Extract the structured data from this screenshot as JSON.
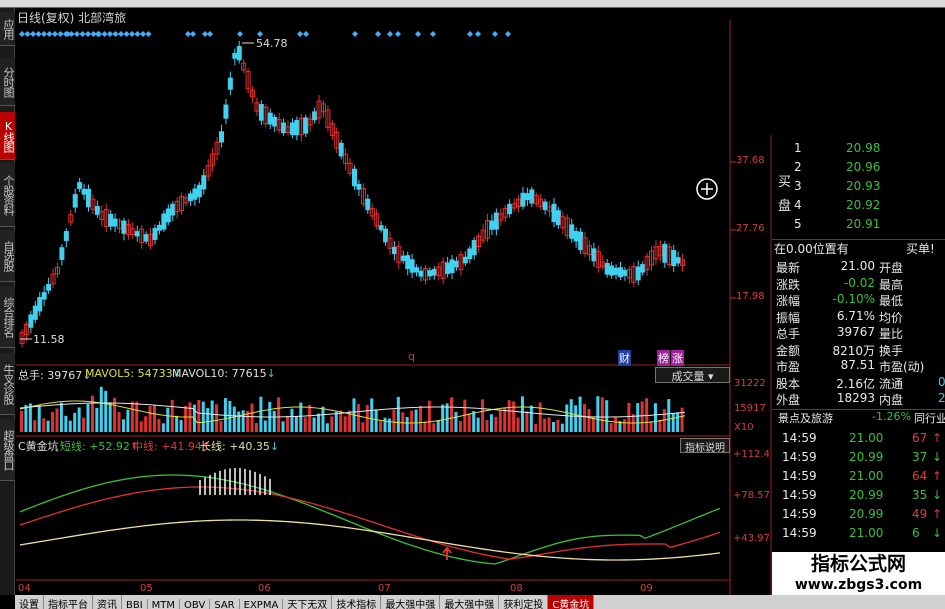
{
  "header": {
    "title": "日线(复权) 北部湾旅"
  },
  "left_tabs": [
    {
      "label": "应用",
      "active": false
    },
    {
      "label": "分时图",
      "active": false
    },
    {
      "label": "K线图",
      "active": true
    },
    {
      "label": "个股资料",
      "active": false
    },
    {
      "label": "自选股",
      "active": false
    },
    {
      "label": "综合排名",
      "active": false
    },
    {
      "label": "牛叉诊股",
      "active": false
    },
    {
      "label": "超级盘口",
      "active": false
    }
  ],
  "price_chart": {
    "high_label": "54.78",
    "low_label": "11.58",
    "axis_ticks": [
      "37.68",
      "27.76",
      "17.98"
    ],
    "markers": [
      "q",
      "财",
      "榜",
      "涨"
    ]
  },
  "volume": {
    "label_total": "总手: 39767",
    "label_ma5": "MAVOL5: 54733",
    "label_ma10": "MAVOL10: 77615",
    "button": "成交量",
    "axis_ticks": [
      "31222",
      "15917",
      "X10"
    ]
  },
  "indicator": {
    "name": "C黄金坑",
    "short_label": "短线: +52.92",
    "mid_label": "中线: +41.94",
    "long_label": "长线: +40.35",
    "button": "指标说明",
    "axis_ticks": [
      "+112.4",
      "+78.57",
      "+43.97"
    ]
  },
  "x_axis": [
    "04",
    "05",
    "06",
    "07",
    "08",
    "09"
  ],
  "order_book": {
    "side_buy_label": "买盘",
    "rows": [
      {
        "level": "1",
        "price": "20.98",
        "vol": ""
      },
      {
        "level": "2",
        "price": "20.96",
        "vol": ""
      },
      {
        "level": "3",
        "price": "20.93",
        "vol": ""
      },
      {
        "level": "4",
        "price": "20.92",
        "vol": ""
      },
      {
        "level": "5",
        "price": "20.91",
        "vol": ""
      }
    ],
    "position_label": "在0.00位置有",
    "buy_label": "买单!"
  },
  "quote": [
    {
      "k1": "最新",
      "v1": "21.00",
      "k2": "开盘",
      "v2": ""
    },
    {
      "k1": "涨跌",
      "v1": "-0.02",
      "k2": "最高",
      "v2": ""
    },
    {
      "k1": "涨幅",
      "v1": "-0.10%",
      "k2": "最低",
      "v2": ""
    },
    {
      "k1": "振幅",
      "v1": "6.71%",
      "k2": "均价",
      "v2": ""
    },
    {
      "k1": "总手",
      "v1": "39767",
      "k2": "量比",
      "v2": ""
    },
    {
      "k1": "金额",
      "v1": "8210万",
      "k2": "换手",
      "v2": ""
    },
    {
      "k1": "市盈",
      "v1": "87.51",
      "k2": "市盈(动)",
      "v2": ""
    },
    {
      "k1": "股本",
      "v1": "2.16亿",
      "k2": "流通",
      "v2": "0"
    },
    {
      "k1": "外盘",
      "v1": "18293",
      "k2": "内盘",
      "v2": "2"
    }
  ],
  "sector": {
    "name": "景点及旅游",
    "change": "-1.26%",
    "tab": "同行业"
  },
  "ticks": [
    {
      "time": "14:59",
      "price": "21.00",
      "vol": "67"
    },
    {
      "time": "14:59",
      "price": "20.99",
      "vol": "37"
    },
    {
      "time": "14:59",
      "price": "21.00",
      "vol": "64"
    },
    {
      "time": "14:59",
      "price": "20.99",
      "vol": "35"
    },
    {
      "time": "14:59",
      "price": "20.99",
      "vol": "49"
    },
    {
      "time": "14:59",
      "price": "21.00",
      "vol": "6"
    }
  ],
  "bottom_tabs": [
    "设置",
    "指标平台",
    "资讯",
    "BBI",
    "MTM",
    "OBV",
    "SAR",
    "EXPMA",
    "天下无双",
    "技术指标",
    "最大强中强",
    "最大强中强",
    "获利定投",
    "C黄金坑"
  ],
  "watermark": {
    "line1": "指标公式网",
    "line2": "www.zbgs3.com"
  }
}
